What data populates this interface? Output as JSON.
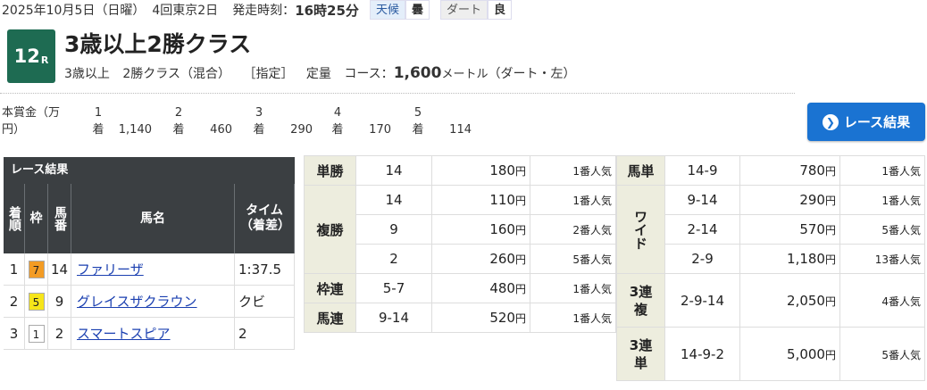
{
  "header": {
    "date": "2025年10月5日（日曜）",
    "meeting": "4回東京2日",
    "post_time_label": "発走時刻：",
    "post_time": "16時25分",
    "weather_label": "天候",
    "weather_value": "曇",
    "track_label": "ダート",
    "track_value": "良"
  },
  "race": {
    "number": "12",
    "number_suffix": "R",
    "title": "3歳以上2勝クラス",
    "info_age": "3歳以上",
    "info_class": "2勝クラス（混合）",
    "info_designation": "［指定］",
    "info_weight": "定量",
    "course_label": "コース：",
    "distance": "1,600",
    "distance_unit": "メートル",
    "course_detail": "（ダート・左）"
  },
  "prize": {
    "label": "本賞金（万円）",
    "places": [
      {
        "rank": "1",
        "suffix": "着",
        "value": "1,140"
      },
      {
        "rank": "2",
        "suffix": "着",
        "value": "460"
      },
      {
        "rank": "3",
        "suffix": "着",
        "value": "290"
      },
      {
        "rank": "4",
        "suffix": "着",
        "value": "170"
      },
      {
        "rank": "5",
        "suffix": "着",
        "value": "114"
      }
    ]
  },
  "result_button": {
    "label": "レース結果"
  },
  "results": {
    "title": "レース結果",
    "headers": {
      "rank": "着順",
      "frame": "枠",
      "number": "馬番",
      "name": "馬名",
      "time": "タイム（着差）"
    },
    "rows": [
      {
        "rank": "1",
        "frame": "7",
        "frame_color": "#f39c25",
        "horse_no": "14",
        "name": "ファリーザ",
        "time": "1:37.5"
      },
      {
        "rank": "2",
        "frame": "5",
        "frame_color": "#f6e51a",
        "horse_no": "9",
        "name": "グレイスザクラウン",
        "time": "クビ"
      },
      {
        "rank": "3",
        "frame": "1",
        "frame_color": "#ffffff",
        "horse_no": "2",
        "name": "スマートスピア",
        "time": "2"
      }
    ]
  },
  "payouts_left": [
    {
      "type": "単勝",
      "combo": "14",
      "amount": "180",
      "unit": "円",
      "pop": "1番人気"
    },
    {
      "type": "複勝",
      "combo": "14",
      "amount": "110",
      "unit": "円",
      "pop": "1番人気"
    },
    {
      "type": "",
      "combo": "9",
      "amount": "160",
      "unit": "円",
      "pop": "2番人気"
    },
    {
      "type": "",
      "combo": "2",
      "amount": "260",
      "unit": "円",
      "pop": "5番人気"
    },
    {
      "type": "枠連",
      "combo": "5-7",
      "amount": "480",
      "unit": "円",
      "pop": "1番人気"
    },
    {
      "type": "馬連",
      "combo": "9-14",
      "amount": "520",
      "unit": "円",
      "pop": "1番人気"
    }
  ],
  "payouts_right": [
    {
      "type": "馬単",
      "combo": "14-9",
      "amount": "780",
      "unit": "円",
      "pop": "1番人気"
    },
    {
      "type": "ワイド",
      "combo": "9-14",
      "amount": "290",
      "unit": "円",
      "pop": "1番人気"
    },
    {
      "type": "",
      "combo": "2-14",
      "amount": "570",
      "unit": "円",
      "pop": "5番人気"
    },
    {
      "type": "",
      "combo": "2-9",
      "amount": "1,180",
      "unit": "円",
      "pop": "13番人気"
    },
    {
      "type": "3連複",
      "combo": "2-9-14",
      "amount": "2,050",
      "unit": "円",
      "pop": "4番人気"
    },
    {
      "type": "3連単",
      "combo": "14-9-2",
      "amount": "5,000",
      "unit": "円",
      "pop": "5番人気"
    }
  ]
}
